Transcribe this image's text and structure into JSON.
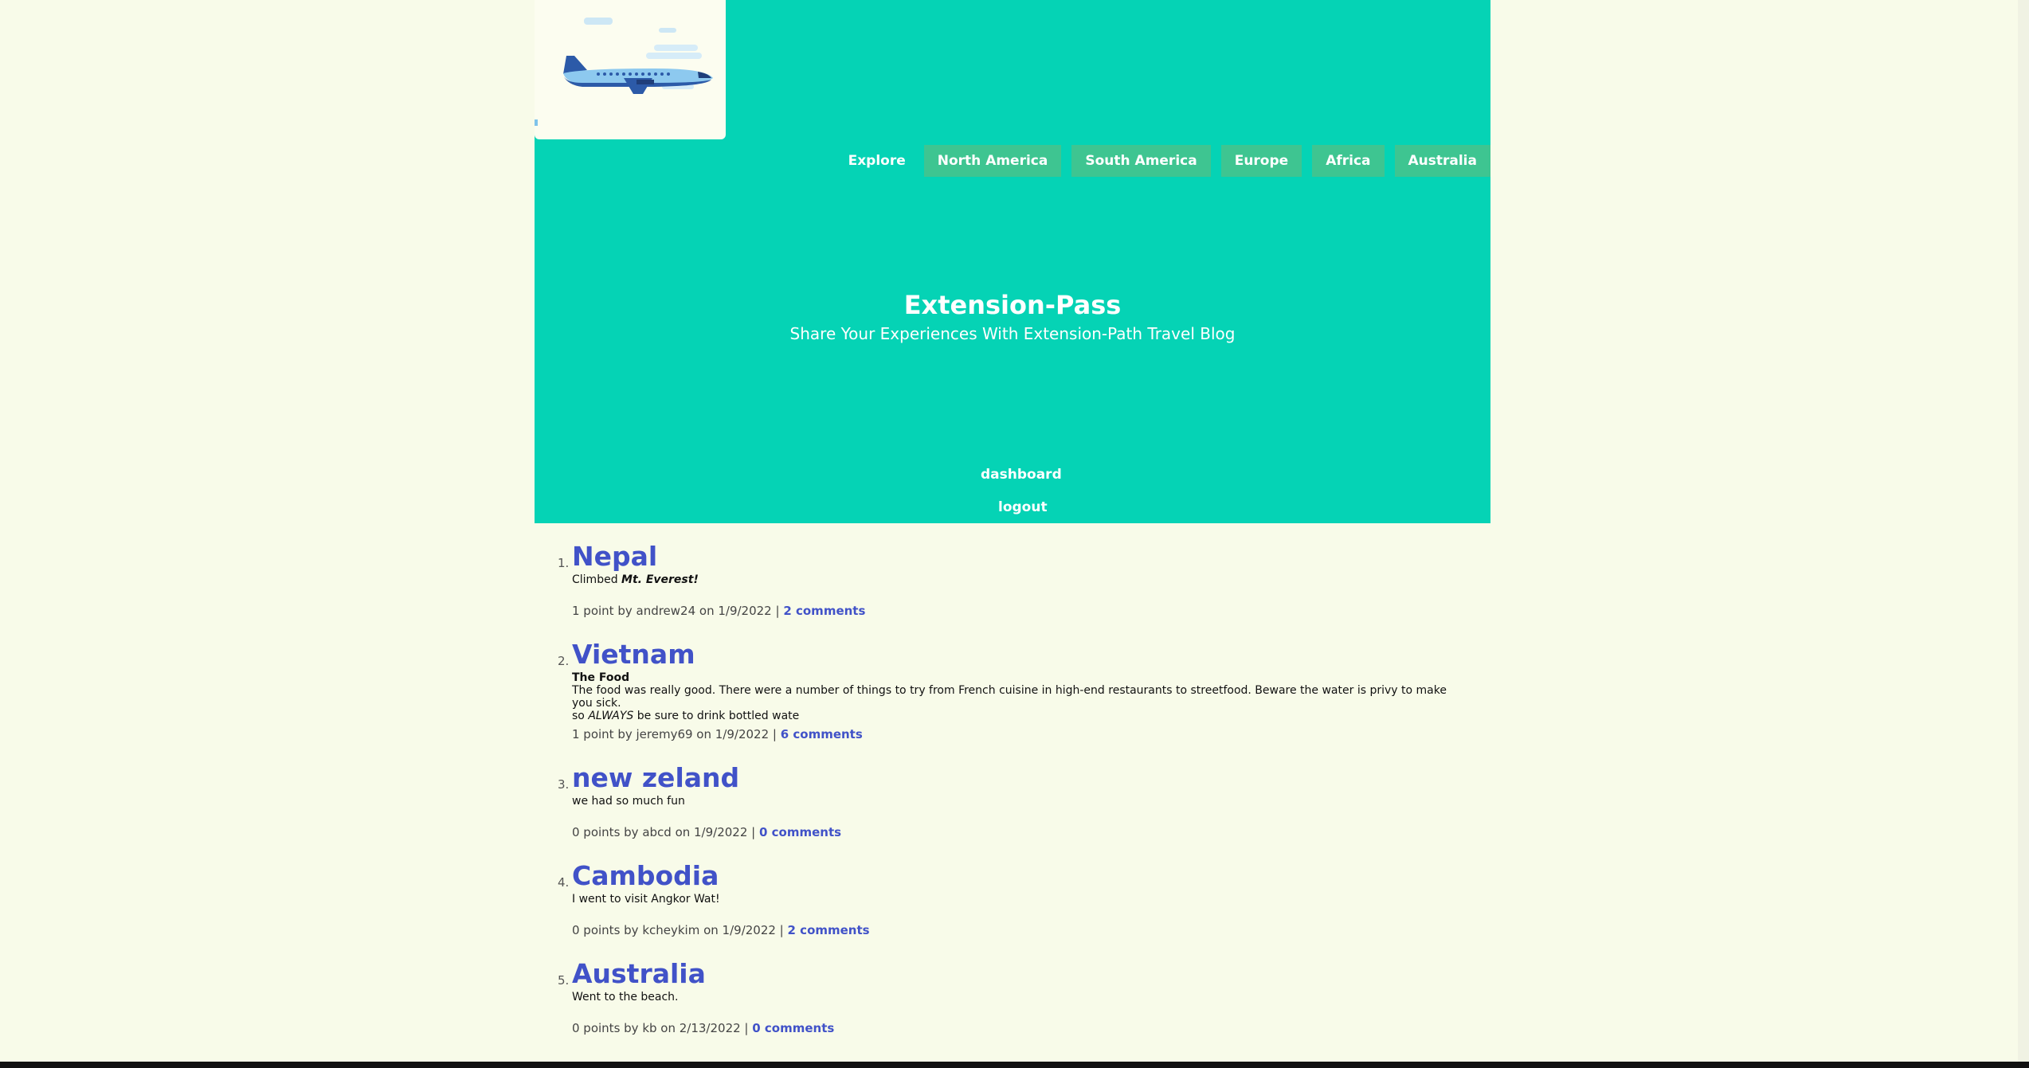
{
  "nav": {
    "explore": "Explore",
    "items": [
      "North America",
      "South America",
      "Europe",
      "Africa",
      "Australia"
    ]
  },
  "site": {
    "title": "Extension-Pass",
    "tagline": "Share Your Experiences With Extension-Path Travel Blog",
    "dashboard": "dashboard",
    "logout": "logout"
  },
  "posts": [
    {
      "num": "1.",
      "title": "Nepal",
      "body_prefix": "Climbed ",
      "body_emph": "Mt. Everest!",
      "meta": "1 point by andrew24 on 1/9/2022 | ",
      "comments": "2 comments"
    },
    {
      "num": "2.",
      "title": "Vietnam",
      "subhead": "The Food",
      "body_line1": "The food was really good. There were a number of things to try from French cuisine in high-end restaurants to streetfood. Beware the water is privy to make you sick.",
      "body_line2_prefix": "so ",
      "body_line2_emph": "ALWAYS",
      "body_line2_suffix": " be sure to drink bottled wate",
      "meta": "1 point by jeremy69 on 1/9/2022 | ",
      "comments": "6 comments"
    },
    {
      "num": "3.",
      "title": "new zeland",
      "body": "we had so much fun",
      "meta": "0 points by abcd on 1/9/2022 | ",
      "comments": "0 comments"
    },
    {
      "num": "4.",
      "title": "Cambodia",
      "body": "I went to visit Angkor Wat!",
      "meta": "0 points by kcheykim on 1/9/2022 | ",
      "comments": "2 comments"
    },
    {
      "num": "5.",
      "title": "Australia",
      "body": "Went to the beach.",
      "meta": "0 points by kb on 2/13/2022 | ",
      "comments": "0 comments"
    }
  ],
  "colors": {
    "header_bg": "#05d3b5",
    "nav_btn_bg": "#3ec591",
    "page_bg": "#f8fbe9",
    "link": "#4152c8"
  }
}
